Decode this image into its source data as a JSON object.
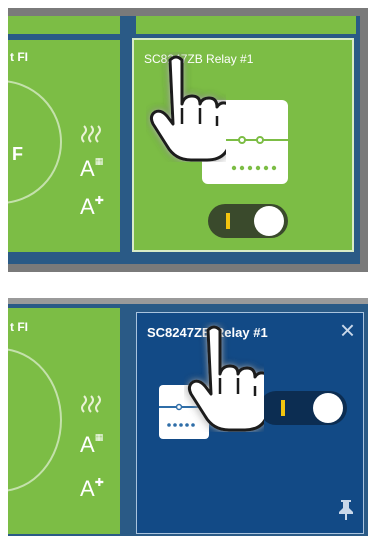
{
  "top_view": {
    "left_tile": {
      "title_fragment": "t FI",
      "temp_unit": "F"
    },
    "relay_tile": {
      "title": "SC8247ZB Relay #1",
      "switch_state": "on"
    }
  },
  "bottom_view": {
    "left_tile": {
      "title_fragment": "t FI"
    },
    "relay_tile": {
      "title": "SC8247ZB Relay #1",
      "switch_state": "on",
      "close_glyph": "×"
    }
  },
  "icons": {
    "heat": "heat-waves-icon",
    "auto_schedule": "auto-schedule-icon",
    "auto_plus": "auto-plus-icon",
    "pin": "pin-icon",
    "hand": "pointing-hand-cursor-icon"
  },
  "colors": {
    "green_tile": "#7cbd45",
    "blue_bg": "#2a5a86",
    "blue_tile": "#124a86",
    "toggle_dark": "#3a4a2c",
    "toggle_accent": "#f2c40f"
  }
}
